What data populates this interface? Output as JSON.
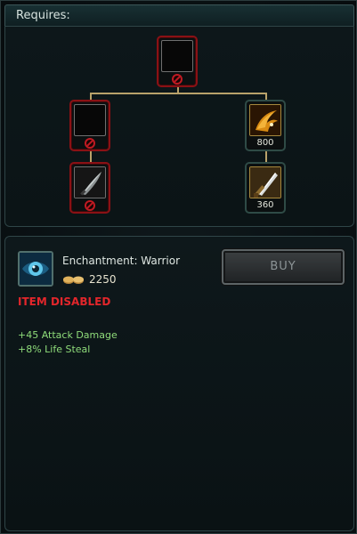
{
  "requires": {
    "title": "Requires:"
  },
  "tree": {
    "root": {
      "state": "disabled",
      "icon": "empty-slot-icon"
    },
    "left_tier2": {
      "state": "disabled",
      "icon": "empty-slot-icon"
    },
    "left_tier3": {
      "state": "disabled",
      "icon": "dagger-icon"
    },
    "right_tier2": {
      "state": "available",
      "icon": "claw-icon",
      "cost": "800"
    },
    "right_tier3": {
      "state": "available",
      "icon": "long-sword-icon",
      "cost": "360"
    }
  },
  "item": {
    "name": "Enchantment: Warrior",
    "price": "2250",
    "status": "ITEM DISABLED",
    "stats": [
      "+45 Attack Damage",
      "+8% Life Steal"
    ],
    "icon": "enchantment-eye-icon"
  },
  "buy_button": {
    "label": "BUY",
    "enabled": false
  },
  "colors": {
    "disabled_border": "#8a1115",
    "disabled_text": "#e3262b",
    "stat_text": "#8fdc7a",
    "connector": "#b9a26a"
  }
}
